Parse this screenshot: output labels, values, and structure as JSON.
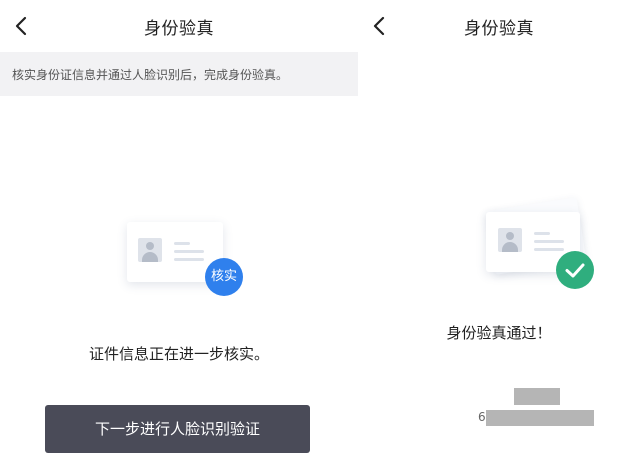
{
  "left": {
    "title": "身份验真",
    "notice": "核实身份证信息并通过人脸识别后，完成身份验真。",
    "badge": "核实",
    "status": "证件信息正在进一步核实。",
    "button": "下一步进行人脸识别验证"
  },
  "right": {
    "title": "身份验真",
    "status": "身份验真通过！",
    "id_prefix": "6"
  },
  "colors": {
    "badge_blue": "#2f80ed",
    "badge_green": "#2fae7e",
    "button_bg": "#4a4b58"
  },
  "icons": [
    "chevron-left-icon",
    "id-card-icon",
    "checkmark-icon"
  ]
}
